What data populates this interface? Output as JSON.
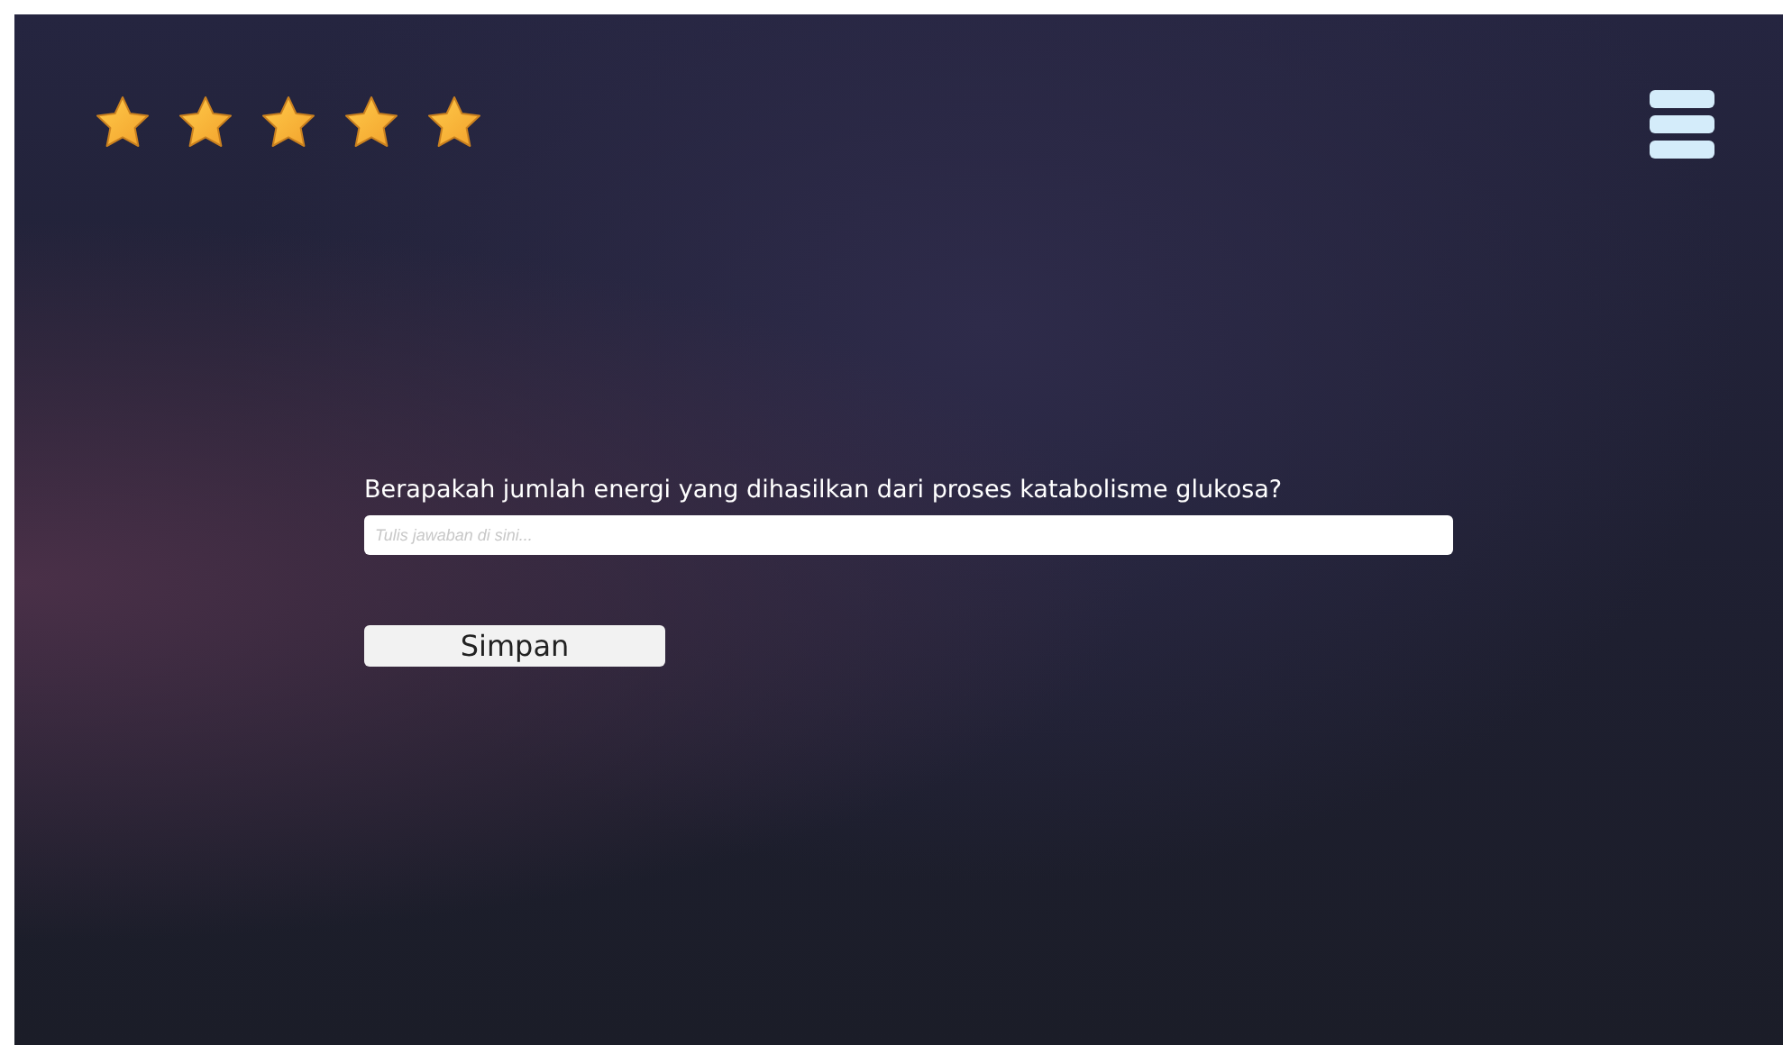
{
  "rating": {
    "stars": 5
  },
  "question": {
    "text": "Berapakah jumlah energi yang dihasilkan dari proses katabolisme glukosa?"
  },
  "answer": {
    "placeholder": "Tulis jawaban di sini..."
  },
  "save_button": {
    "label": "Simpan"
  }
}
